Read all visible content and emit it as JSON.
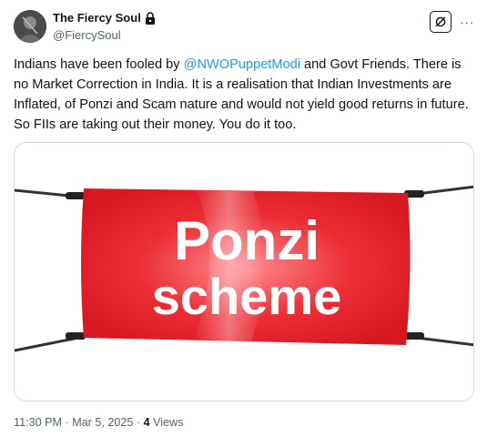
{
  "author": {
    "display_name": "The Fiercy Soul",
    "handle": "@FiercySoul",
    "verified_icon": "lock-icon",
    "avatar_icon": "avatar-image"
  },
  "actions": {
    "grok_icon": "grok-icon",
    "more_icon": "more-dots-icon",
    "more_label": "···"
  },
  "tweet": {
    "text_before": "Indians have been fooled by ",
    "mention": "@NWOPuppetModi",
    "text_after": " and Govt Friends. There is no Market Correction in India. It is a realisation that Indian Investments are Inflated, of Ponzi and Scam nature and would not yield good returns in future. So FIIs are taking out their money. You do it too."
  },
  "media": {
    "banner_line1": "Ponzi",
    "banner_line2": "scheme",
    "banner_color": "#e8202a"
  },
  "meta": {
    "time": "11:30 PM",
    "sep1": " · ",
    "date": "Mar 5, 2025",
    "sep2": " · ",
    "views_count": "4",
    "views_label": " Views"
  },
  "colors": {
    "text": "#0f1419",
    "secondary": "#536471",
    "link": "#1d9bf0",
    "border": "#cfd9de"
  }
}
